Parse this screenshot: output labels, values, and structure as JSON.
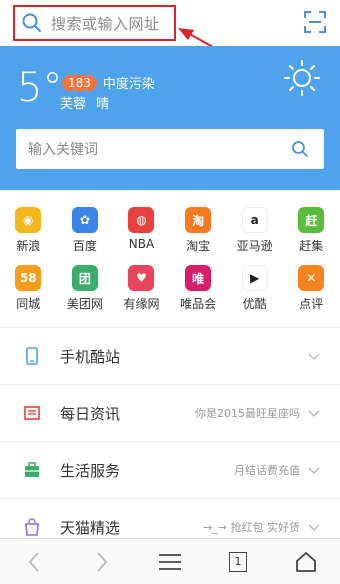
{
  "top": {
    "search_placeholder": "搜索或输入网址"
  },
  "weather": {
    "temperature": "5°",
    "aqi_value": "183",
    "aqi_label": "中度污染",
    "city": "芙蓉",
    "condition": "晴"
  },
  "hero_search": {
    "placeholder": "输入关键词"
  },
  "apps_row1": [
    {
      "label": "新浪",
      "icon": "weibo-icon",
      "color": "#f3b71f",
      "glyph": "◉"
    },
    {
      "label": "百度",
      "icon": "baidu-paw-icon",
      "color": "#3b84e8",
      "glyph": "✿"
    },
    {
      "label": "NBA",
      "icon": "basketball-icon",
      "color": "#e8413e",
      "glyph": "◍"
    },
    {
      "label": "淘宝",
      "icon": "taobao-icon",
      "color": "#f4791f",
      "glyph": "淘"
    },
    {
      "label": "亚马逊",
      "icon": "amazon-icon",
      "color": "#ffffff",
      "glyph": "a"
    },
    {
      "label": "赶集",
      "icon": "ganji-icon",
      "color": "#5bbd3c",
      "glyph": "赶"
    }
  ],
  "apps_row2": [
    {
      "label": "同城",
      "icon": "58-icon",
      "color": "#f39d1a",
      "glyph": "58"
    },
    {
      "label": "美团网",
      "icon": "meituan-icon",
      "color": "#3dae6a",
      "glyph": "团"
    },
    {
      "label": "有缘网",
      "icon": "youyuan-icon",
      "color": "#e8445b",
      "glyph": "♥"
    },
    {
      "label": "唯品会",
      "icon": "vip-icon",
      "color": "#d81e6b",
      "glyph": "唯"
    },
    {
      "label": "优酷",
      "icon": "youku-icon",
      "color": "#ffffff",
      "glyph": "▶"
    },
    {
      "label": "点评",
      "icon": "dianping-icon",
      "color": "#f5831f",
      "glyph": "✕"
    }
  ],
  "list": [
    {
      "title": "手机酷站",
      "subtitle": "",
      "icon": "phone-icon",
      "color": "#4ea3ec"
    },
    {
      "title": "每日资讯",
      "subtitle": "你是2015最旺星座吗",
      "icon": "news-icon",
      "color": "#e8413e"
    },
    {
      "title": "生活服务",
      "subtitle": "月结话费充值",
      "icon": "toolbox-icon",
      "color": "#3dae6a"
    },
    {
      "title": "天猫精选",
      "subtitle": "→_→ 抢红包 实好货",
      "icon": "tmall-bag-icon",
      "color": "#9a6ad6"
    }
  ],
  "bottom": {
    "tab_count": "1"
  }
}
